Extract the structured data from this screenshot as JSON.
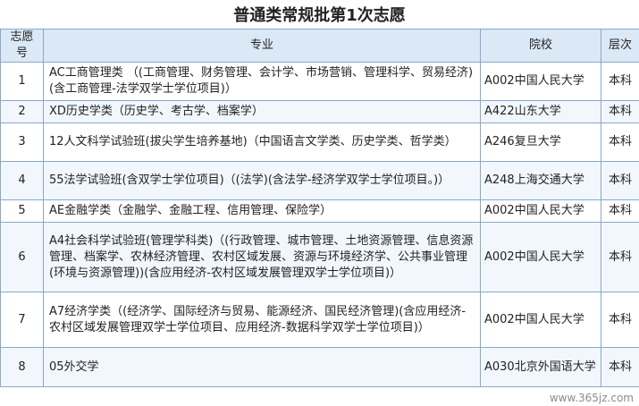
{
  "title": "普通类常规批第1次志愿",
  "headers": [
    "志愿号",
    "专业",
    "院校",
    "层次"
  ],
  "rows": [
    {
      "num": "1",
      "major": "AC工商管理类 （(工商管理、财务管理、会计学、市场营销、管理科学、贸易经济)(含工商管理-法学双学士学位项目)）",
      "school": "A002中国人民大学",
      "level": "本科"
    },
    {
      "num": "2",
      "major": "XD历史学类（历史学、考古学、档案学）",
      "school": "A422山东大学",
      "level": "本科"
    },
    {
      "num": "3",
      "major": "12人文科学试验班(拔尖学生培养基地)（中国语言文学类、历史学类、哲学类）",
      "school": "A246复旦大学",
      "level": "本科"
    },
    {
      "num": "4",
      "major": "55法学试验班(含双学士学位项目)（(法学)(含法学-经济学双学士学位项目。)）",
      "school": "A248上海交通大学",
      "level": "本科"
    },
    {
      "num": "5",
      "major": "AE金融学类（金融学、金融工程、信用管理、保险学）",
      "school": "A002中国人民大学",
      "level": "本科"
    },
    {
      "num": "6",
      "major": "A4社会科学试验班(管理学科类)（(行政管理、城市管理、土地资源管理、信息资源管理、档案学、农林经济管理、农村区域发展、资源与环境经济学、公共事业管理(环境与资源管理))(含应用经济-农村区域发展管理双学士学位项目)）",
      "school": "A002中国人民大学",
      "level": "本科"
    },
    {
      "num": "7",
      "major": "A7经济学类（(经济学、国际经济与贸易、能源经济、国民经济管理)(含应用经济-农村区域发展管理双学士学位项目、应用经济-数据科学双学士学位项目)）",
      "school": "A002中国人民大学",
      "level": "本科"
    },
    {
      "num": "8",
      "major": "05外交学",
      "school": "A030北京外国语大学",
      "level": "本科"
    }
  ],
  "watermark": "www.365jz.com"
}
